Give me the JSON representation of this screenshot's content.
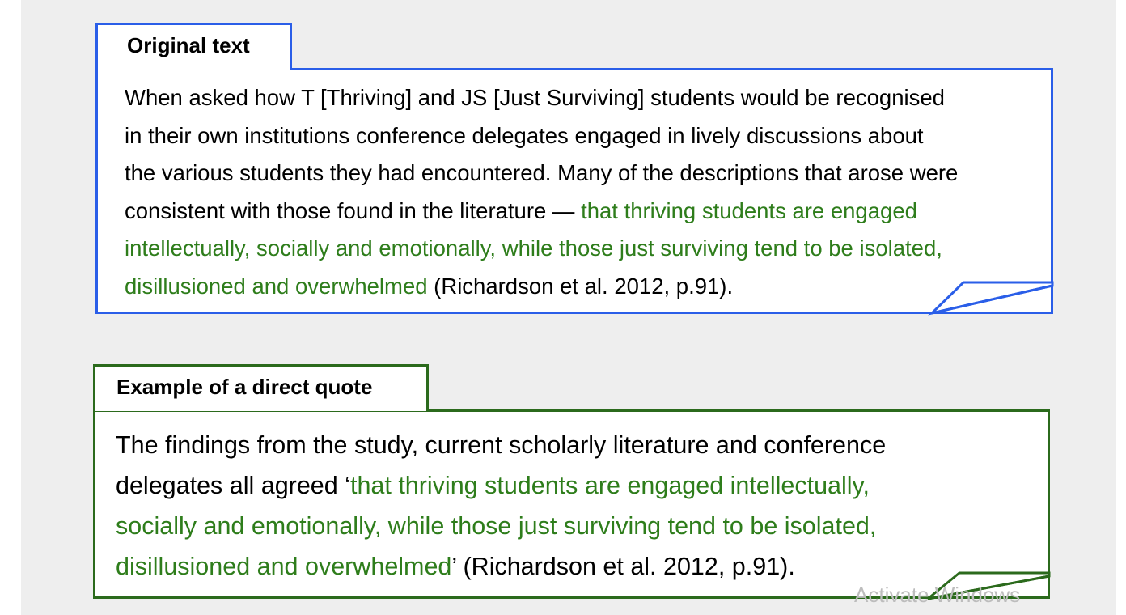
{
  "colors": {
    "background": "#eeeeee",
    "box1_border": "#2a5ee8",
    "box2_border": "#2b6a1c",
    "quote_highlight": "#2e7d1b"
  },
  "original": {
    "tab_label": "Original text",
    "lines": [
      [
        {
          "t": "When asked how T [Thriving] and JS [Just Surviving] students would be recognised",
          "hl": false
        }
      ],
      [
        {
          "t": "in their own institutions conference delegates engaged in lively discussions about",
          "hl": false
        }
      ],
      [
        {
          "t": "the various students they had encountered. Many of the descriptions that arose were",
          "hl": false
        }
      ],
      [
        {
          "t": "consistent with those found in the literature — ",
          "hl": false
        },
        {
          "t": "that thriving students are engaged",
          "hl": true
        }
      ],
      [
        {
          "t": "intellectually, socially and emotionally, while those just surviving tend to be isolated,",
          "hl": true
        }
      ],
      [
        {
          "t": "disillusioned and overwhelmed",
          "hl": true
        },
        {
          "t": " (Richardson et al. 2012, p.91).",
          "hl": false
        }
      ]
    ]
  },
  "direct_quote": {
    "tab_label": "Example of a direct quote",
    "lines": [
      [
        {
          "t": "The findings from the study, current scholarly literature and conference",
          "hl": false
        }
      ],
      [
        {
          "t": "delegates all agreed ‘",
          "hl": false
        },
        {
          "t": "that thriving students are engaged intellectually,",
          "hl": true
        }
      ],
      [
        {
          "t": "socially and emotionally, while those just surviving tend to be isolated,",
          "hl": true
        }
      ],
      [
        {
          "t": "disillusioned and overwhelmed",
          "hl": true
        },
        {
          "t": "’ (Richardson et al. 2012, p.91).",
          "hl": false
        }
      ]
    ]
  },
  "watermark": "Activate Windows"
}
